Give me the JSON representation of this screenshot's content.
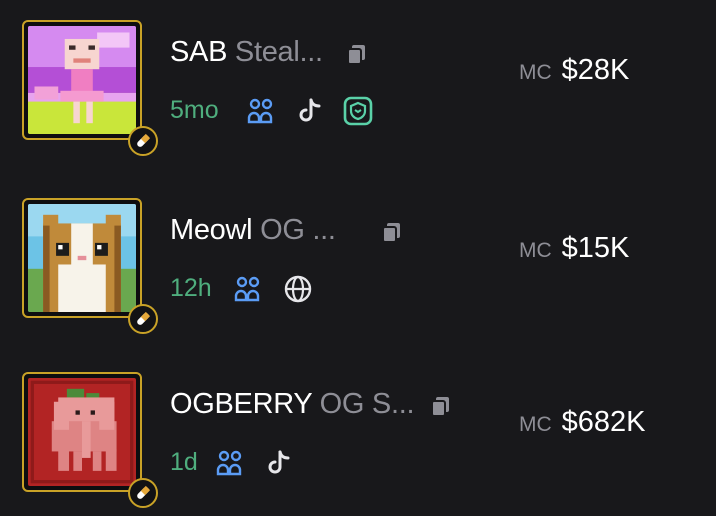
{
  "tokens": [
    {
      "ticker": "SAB",
      "name": "Steal...",
      "age": "5mo",
      "mc_label": "MC",
      "mc_value": "$28K",
      "socials": [
        "holders-icon",
        "tiktok-icon",
        "dex-shield-icon"
      ]
    },
    {
      "ticker": "Meowl",
      "name": "OG ...",
      "age": "12h",
      "mc_label": "MC",
      "mc_value": "$15K",
      "socials": [
        "holders-icon",
        "globe-icon"
      ]
    },
    {
      "ticker": "OGBERRY",
      "name": "OG S...",
      "age": "1d",
      "mc_label": "MC",
      "mc_value": "$682K",
      "socials": [
        "holders-icon",
        "tiktok-icon"
      ]
    }
  ],
  "colors": {
    "background": "#18181b",
    "thumb_border": "#c9a227",
    "age_green": "#4fae7e",
    "holders_blue": "#5b9cf5",
    "muted_gray": "#8e8e96",
    "dex_teal": "#5ad1a8"
  }
}
